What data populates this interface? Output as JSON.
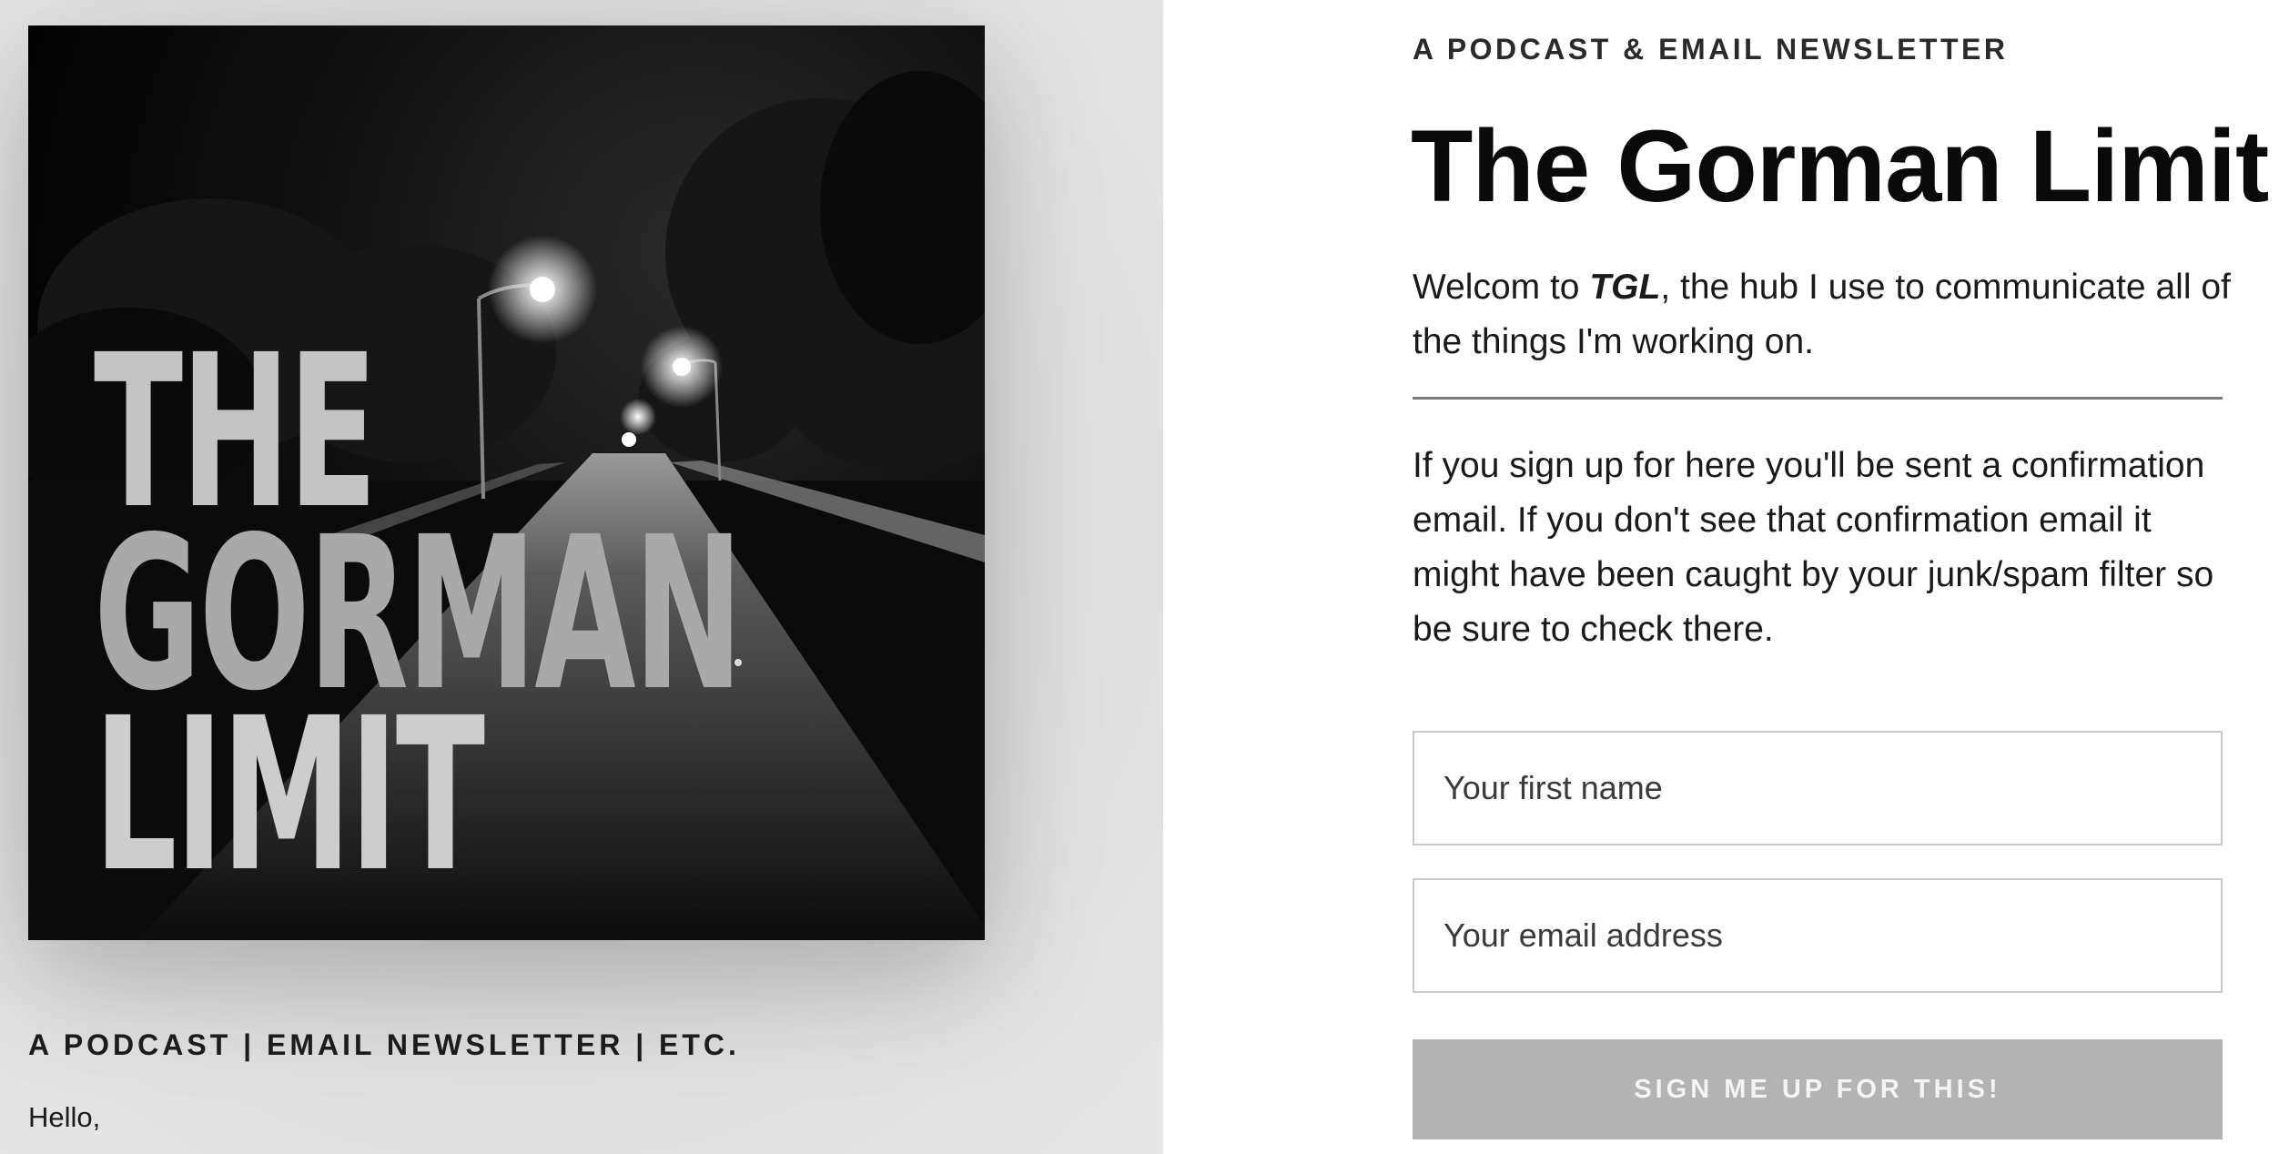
{
  "cover": {
    "title_line1": "THE",
    "title_line2": "GORMAN",
    "title_line3": "LIMIT"
  },
  "left": {
    "tagline": "A PODCAST | EMAIL NEWSLETTER | ETC.",
    "greeting": "Hello,"
  },
  "signup": {
    "eyebrow": "A PODCAST & EMAIL NEWSLETTER",
    "title": "The Gorman Limit",
    "intro_prefix": "Welcom to ",
    "intro_emphasis": "TGL",
    "intro_suffix": ", the hub I use to communicate all of the things I'm working on.",
    "notice": "If you sign up for here you'll be sent a confirmation email. If you don't see that confirmation email it might have been caught by your junk/spam filter so be sure to check there.",
    "first_name_placeholder": "Your first name",
    "email_placeholder": "Your email address",
    "submit_label": "SIGN ME UP FOR THIS!"
  },
  "colors": {
    "left_background": "#dcdcdc",
    "submit_background": "#b3b3b3",
    "divider": "#7a7a7a"
  }
}
